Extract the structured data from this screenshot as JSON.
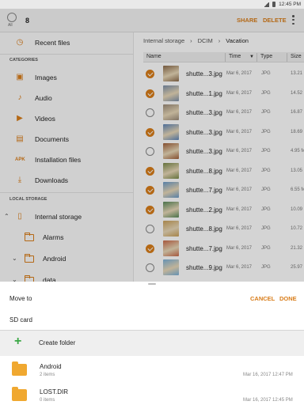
{
  "status_bar": {
    "time": "12:45 PM"
  },
  "top_bar": {
    "all_label": "All",
    "selected_count": "8",
    "share_label": "SHARE",
    "delete_label": "DELETE"
  },
  "sidebar": {
    "recent": "Recent files",
    "categories_header": "CATEGORIES",
    "categories": [
      {
        "label": "Images",
        "icon": "image-icon"
      },
      {
        "label": "Audio",
        "icon": "music-note-icon"
      },
      {
        "label": "Videos",
        "icon": "video-icon"
      },
      {
        "label": "Documents",
        "icon": "document-icon"
      },
      {
        "label": "Installation files",
        "icon": "apk-icon",
        "icon_text": "APK"
      },
      {
        "label": "Downloads",
        "icon": "download-icon"
      }
    ],
    "local_storage_header": "LOCAL STORAGE",
    "internal_storage": "Internal storage",
    "folders": [
      "Alarms",
      "Android",
      "data"
    ]
  },
  "content": {
    "breadcrumb": [
      "Internal storage",
      "DCIM",
      "Vacation"
    ],
    "columns": {
      "name": "Name",
      "time": "Time",
      "type": "Type",
      "size": "Size"
    },
    "files": [
      {
        "name": "shutte...3.jpg",
        "time": "Mar 6, 2017",
        "type": "JPG",
        "size": "13.21",
        "checked": true,
        "thumb": "#8a6a4a"
      },
      {
        "name": "shutte...1.jpg",
        "time": "Mar 6, 2017",
        "type": "JPG",
        "size": "14.52",
        "checked": true,
        "thumb": "#7c8fa8"
      },
      {
        "name": "shutte...3.jpg",
        "time": "Mar 6, 2017",
        "type": "JPG",
        "size": "16.87",
        "checked": false,
        "thumb": "#9a8a78"
      },
      {
        "name": "shutte...3.jpg",
        "time": "Mar 6, 2017",
        "type": "JPG",
        "size": "18.69",
        "checked": true,
        "thumb": "#5f86b8"
      },
      {
        "name": "shutte...3.jpg",
        "time": "Mar 6, 2017",
        "type": "JPG",
        "size": "4.95 M",
        "checked": false,
        "thumb": "#a0603a"
      },
      {
        "name": "shutte...8.jpg",
        "time": "Mar 6, 2017",
        "type": "JPG",
        "size": "13.05",
        "checked": true,
        "thumb": "#7a8a4a"
      },
      {
        "name": "shutte...7.jpg",
        "time": "Mar 6, 2017",
        "type": "JPG",
        "size": "6.55 M",
        "checked": true,
        "thumb": "#6a9ac8"
      },
      {
        "name": "shutte...2.jpg",
        "time": "Mar 6, 2017",
        "type": "JPG",
        "size": "10.09",
        "checked": true,
        "thumb": "#5a8a5a"
      },
      {
        "name": "shutte...8.jpg",
        "time": "Mar 6, 2017",
        "type": "JPG",
        "size": "10.72",
        "checked": false,
        "thumb": "#c8a05a"
      },
      {
        "name": "shutte...7.jpg",
        "time": "Mar 6, 2017",
        "type": "JPG",
        "size": "21.32",
        "checked": true,
        "thumb": "#c86a4a"
      },
      {
        "name": "shutte...9.jpg",
        "time": "Mar 6, 2017",
        "type": "JPG",
        "size": "25.97",
        "checked": false,
        "thumb": "#7ab0d8"
      }
    ]
  },
  "move_sheet": {
    "title": "Move to",
    "cancel_label": "CANCEL",
    "done_label": "DONE",
    "sd_card": "SD card",
    "create_folder": "Create folder",
    "folders": [
      {
        "name": "Android",
        "items": "2 items",
        "date": "Mar 16, 2017 12:47 PM"
      },
      {
        "name": "LOST.DIR",
        "items": "0 items",
        "date": "Mar 16, 2017 12:45 PM"
      }
    ]
  },
  "colors": {
    "accent": "#d97d1a",
    "create_plus": "#3aa845",
    "folder": "#f0a830"
  }
}
